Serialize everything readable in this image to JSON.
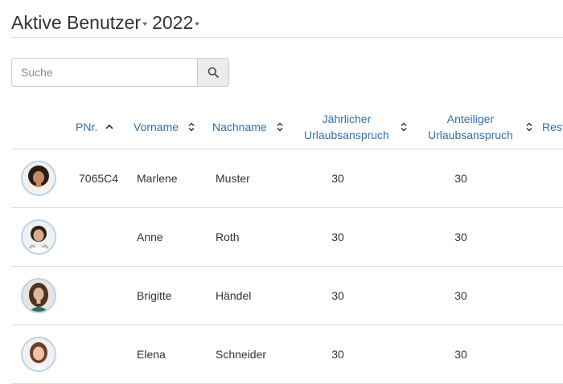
{
  "header": {
    "title": "Aktive Benutzer",
    "year": "2022"
  },
  "search": {
    "placeholder": "Suche"
  },
  "table": {
    "columns": {
      "pnr": "PNr.",
      "vorname": "Vorname",
      "nachname": "Nachname",
      "jaehrlich_line1": "Jährlicher",
      "jaehrlich_line2": "Urlaubsanspruch",
      "anteilig_line1": "Anteiliger",
      "anteilig_line2": "Urlaubsanspruch",
      "rest": "Rest"
    },
    "rows": [
      {
        "pnr": "7065C4",
        "vorname": "Marlene",
        "nachname": "Muster",
        "jaehrlich": "30",
        "anteilig": "30"
      },
      {
        "pnr": "",
        "vorname": "Anne",
        "nachname": "Roth",
        "jaehrlich": "30",
        "anteilig": "30"
      },
      {
        "pnr": "",
        "vorname": "Brigitte",
        "nachname": "Händel",
        "jaehrlich": "30",
        "anteilig": "30"
      },
      {
        "pnr": "",
        "vorname": "Elena",
        "nachname": "Schneider",
        "jaehrlich": "30",
        "anteilig": "30"
      }
    ]
  },
  "colors": {
    "link": "#336fa8",
    "avatar_ring": "#b7d3ef"
  }
}
